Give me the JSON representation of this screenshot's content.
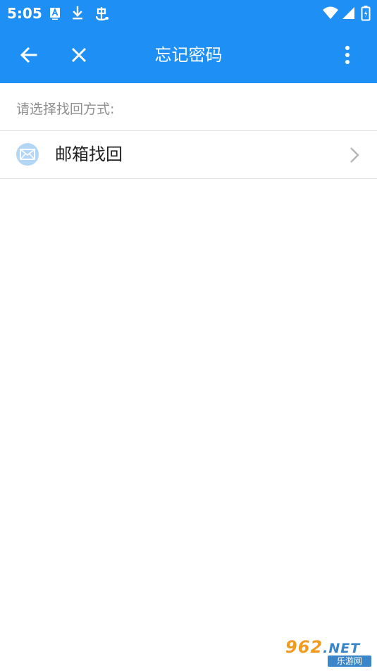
{
  "status_bar": {
    "time": "5:05",
    "left_icons": [
      "font-a-icon",
      "download-icon",
      "bug-icon"
    ],
    "right_icons": [
      "wifi-icon",
      "signal-icon",
      "battery-icon"
    ]
  },
  "toolbar": {
    "title": "忘记密码",
    "back_icon": "arrow-left-icon",
    "close_icon": "close-icon",
    "more_icon": "more-vert-icon"
  },
  "content": {
    "hint": "请选择找回方式:",
    "methods": [
      {
        "label": "邮箱找回",
        "icon": "mail-icon"
      }
    ]
  },
  "watermark": {
    "main_digits": "962",
    "main_suffix": ".NET",
    "sub": "乐游网"
  },
  "colors": {
    "primary": "#1e90f5",
    "hint_text": "#8f8f8f",
    "divider": "#e2e2e2",
    "mail_icon_bg": "#b3d6f6",
    "label_text": "#222222"
  }
}
